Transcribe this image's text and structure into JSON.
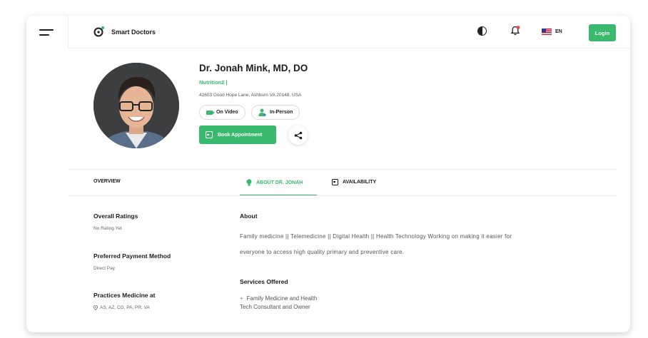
{
  "header": {
    "brand": "Smart Doctors",
    "lang": "EN",
    "login_label": "Login"
  },
  "doctor": {
    "name": "Dr. Jonah Mink, MD, DO",
    "specialty": "Nutrition2 |",
    "address": "42603 Good Hope Lane, Ashburn VA 20148, USA",
    "modes": [
      "On Video",
      "In-Person"
    ],
    "book_label": "Book Appointment"
  },
  "tabs": {
    "overview": "OVERVIEW",
    "about": "ABOUT DR. JONAH",
    "availability": "AVAILABILITY",
    "active": "about"
  },
  "sidebar": {
    "ratings_title": "Overall Ratings",
    "ratings_value": "No Rating Yet",
    "payment_title": "Preferred Payment Method",
    "payment_value": "Direct Pay",
    "practices_title": "Practices Medicine at",
    "practices_value": "AS, AZ, CO, PA, PR, VA"
  },
  "about": {
    "title": "About",
    "text_line1": "Family medicine || Telemedicine || Digital Health || Health Technology Working on making it easier for",
    "text_line2": "everyone to access high quality primary and preventive care.",
    "services_title": "Services Offered",
    "services": [
      "Family Medicine and Health",
      "Tech Consultant and Owner"
    ]
  },
  "colors": {
    "accent": "#39b96e",
    "text": "#1d1d1f",
    "muted": "#666666"
  },
  "icons": [
    "menu-icon",
    "logo-icon",
    "contrast-icon",
    "bell-icon",
    "us-flag-icon",
    "video-icon",
    "person-icon",
    "calendar-icon",
    "share-icon",
    "lightbulb-icon",
    "location-pin-icon"
  ]
}
